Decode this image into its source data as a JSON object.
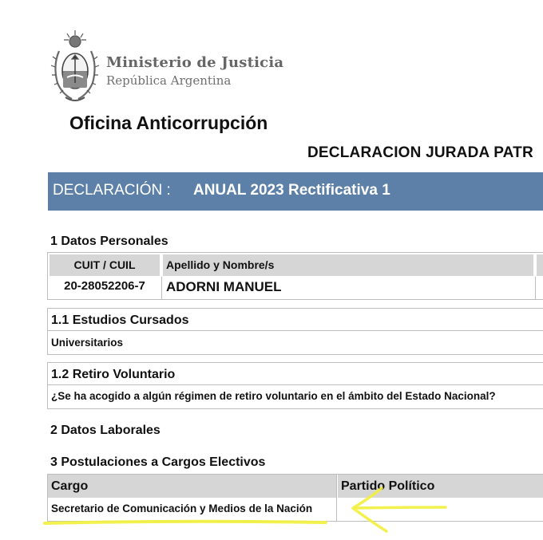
{
  "header": {
    "ministry_line1": "Ministerio de Justicia",
    "ministry_line2": "República Argentina",
    "office": "Oficina Anticorrupción",
    "document_title": "DECLARACION JURADA PATR"
  },
  "declaration": {
    "label": "DECLARACIÓN :",
    "value": "ANUAL 2023 Rectificativa 1"
  },
  "personal": {
    "heading": "1 Datos Personales",
    "col_cuit": "CUIT / CUIL",
    "col_name": "Apellido y Nombre/s",
    "cuit": "20-28052206-7",
    "name": "ADORNI MANUEL"
  },
  "studies": {
    "heading": "1.1 Estudios Cursados",
    "value": "Universitarios"
  },
  "retirement": {
    "heading": "1.2 Retiro Voluntario",
    "question": "¿Se ha acogido a algún régimen de retiro voluntario en el ámbito del Estado Nacional?"
  },
  "labor": {
    "heading": "2 Datos Laborales"
  },
  "candidacies": {
    "heading": "3 Postulaciones a Cargos Electivos",
    "col_cargo": "Cargo",
    "col_partido": "Partido Político",
    "cargo_value": "Secretario de Comunicación y Medios de la Nación"
  },
  "colors": {
    "bar_blue": "#5d80a8",
    "header_gray": "#d6d6d6",
    "highlight_yellow": "#f2ef3a"
  }
}
